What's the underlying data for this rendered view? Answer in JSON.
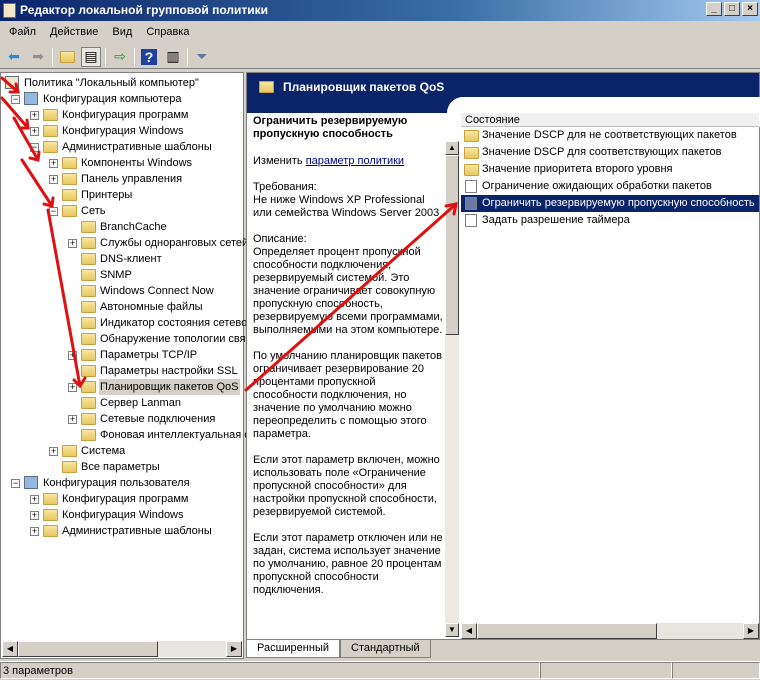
{
  "window": {
    "title": "Редактор локальной групповой политики",
    "minimize": "_",
    "maximize": "□",
    "close": "×"
  },
  "menu": [
    "Файл",
    "Действие",
    "Вид",
    "Справка"
  ],
  "toolbar": {
    "back": "back-icon",
    "forward": "forward-icon",
    "up": "up-folder-icon",
    "show_tree": "show-tree-icon",
    "export": "export-icon",
    "help": "?",
    "show_action": "action-pane-icon",
    "filter": "filter-icon"
  },
  "tree": [
    {
      "label": "Политика \"Локальный компьютер\"",
      "level": 0,
      "exp": ""
    },
    {
      "label": "Конфигурация компьютера",
      "level": 1,
      "exp": "−"
    },
    {
      "label": "Конфигурация программ",
      "level": 2,
      "exp": "+"
    },
    {
      "label": "Конфигурация Windows",
      "level": 2,
      "exp": "+"
    },
    {
      "label": "Административные шаблоны",
      "level": 2,
      "exp": "−"
    },
    {
      "label": "Компоненты Windows",
      "level": 3,
      "exp": "+"
    },
    {
      "label": "Панель управления",
      "level": 3,
      "exp": "+"
    },
    {
      "label": "Принтеры",
      "level": 3,
      "exp": ""
    },
    {
      "label": "Сеть",
      "level": 3,
      "exp": "−"
    },
    {
      "label": "BranchCache",
      "level": 4,
      "exp": ""
    },
    {
      "label": "Службы одноранговых сетей",
      "level": 4,
      "exp": "+"
    },
    {
      "label": "DNS-клиент",
      "level": 4,
      "exp": ""
    },
    {
      "label": "SNMP",
      "level": 4,
      "exp": ""
    },
    {
      "label": "Windows Connect Now",
      "level": 4,
      "exp": ""
    },
    {
      "label": "Автономные файлы",
      "level": 4,
      "exp": ""
    },
    {
      "label": "Индикатор состояния сетевого подключения",
      "level": 4,
      "exp": ""
    },
    {
      "label": "Обнаружение топологии связи",
      "level": 4,
      "exp": ""
    },
    {
      "label": "Параметры TCP/IP",
      "level": 4,
      "exp": "+"
    },
    {
      "label": "Параметры настройки SSL",
      "level": 4,
      "exp": ""
    },
    {
      "label": "Планировщик пакетов QoS",
      "level": 4,
      "exp": "+",
      "selected": true
    },
    {
      "label": "Сервер Lanman",
      "level": 4,
      "exp": ""
    },
    {
      "label": "Сетевые подключения",
      "level": 4,
      "exp": "+"
    },
    {
      "label": "Фоновая интеллектуальная служба передачи",
      "level": 4,
      "exp": ""
    },
    {
      "label": "Система",
      "level": 3,
      "exp": "+"
    },
    {
      "label": "Все параметры",
      "level": 3,
      "exp": ""
    },
    {
      "label": "Конфигурация пользователя",
      "level": 1,
      "exp": "−"
    },
    {
      "label": "Конфигурация программ",
      "level": 2,
      "exp": "+"
    },
    {
      "label": "Конфигурация Windows",
      "level": 2,
      "exp": "+"
    },
    {
      "label": "Административные шаблоны",
      "level": 2,
      "exp": "+"
    }
  ],
  "header": {
    "title": "Планировщик пакетов QoS"
  },
  "description": {
    "title": "Ограничить резервируемую пропускную способность",
    "edit_prefix": "Изменить ",
    "edit_link": "параметр политики",
    "requirements_label": "Требования:",
    "requirements": "Не ниже Windows XP Professional или семейства Windows Server 2003",
    "description_label": "Описание:",
    "p1": "Определяет процент пропускной способности подключения, резервируемый системой. Это значение ограничивает совокупную пропускную способность, резервируемую всеми программами, выполняемыми на этом компьютере.",
    "p2": "По умолчанию планировщик пакетов ограничивает резервирование 20 процентами пропускной способности подключения, но значение по умолчанию можно переопределить с помощью этого параметра.",
    "p3": "Если этот параметр включен, можно использовать поле «Ограничение пропускной способности» для настройки пропускной способности, резервируемой системой.",
    "p4": "Если этот параметр отключен или не задан, система использует значение по умолчанию, равное 20 процентам пропускной способности подключения."
  },
  "list": {
    "column": "Состояние",
    "items": [
      {
        "label": "Значение DSCP для не соответствующих пакетов",
        "type": "folder"
      },
      {
        "label": "Значение DSCP для соответствующих пакетов",
        "type": "folder"
      },
      {
        "label": "Значение приоритета второго уровня",
        "type": "folder"
      },
      {
        "label": "Ограничение ожидающих обработки пакетов",
        "type": "setting"
      },
      {
        "label": "Ограничить резервируемую пропускную способность",
        "type": "setting",
        "selected": true
      },
      {
        "label": "Задать разрешение таймера",
        "type": "setting"
      }
    ]
  },
  "tabs": [
    "Расширенный",
    "Стандартный"
  ],
  "status": {
    "text": "3 параметров"
  }
}
